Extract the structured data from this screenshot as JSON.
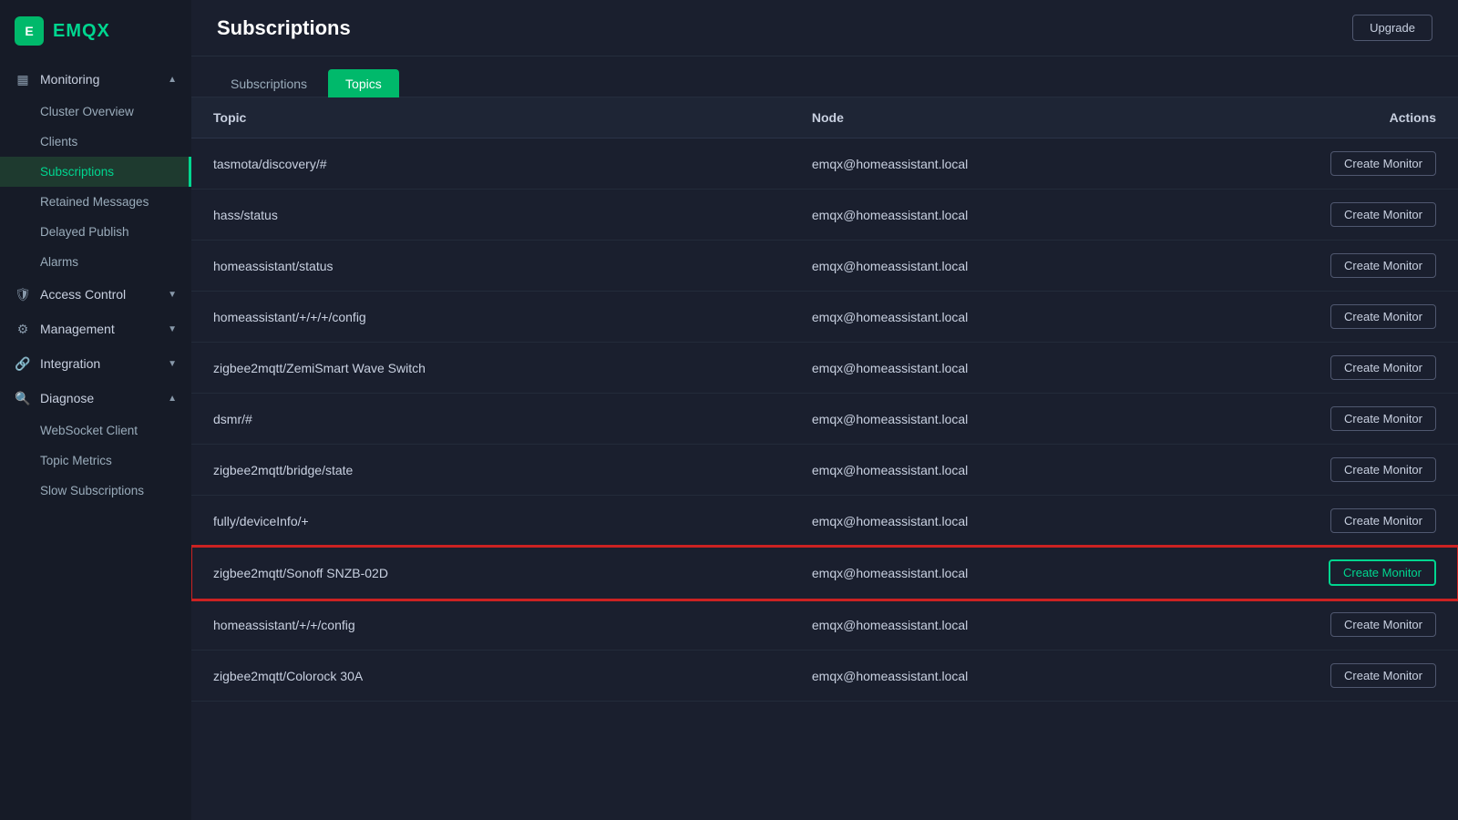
{
  "logo": {
    "icon": "E",
    "text": "EMQX"
  },
  "topbar": {
    "title": "Subscriptions",
    "upgrade_label": "Upgrade"
  },
  "sidebar": {
    "groups": [
      {
        "icon": "▦",
        "label": "Monitoring",
        "expanded": true,
        "items": [
          {
            "label": "Cluster Overview",
            "active": false
          },
          {
            "label": "Clients",
            "active": false
          },
          {
            "label": "Subscriptions",
            "active": true
          },
          {
            "label": "Retained Messages",
            "active": false
          },
          {
            "label": "Delayed Publish",
            "active": false
          },
          {
            "label": "Alarms",
            "active": false
          }
        ]
      },
      {
        "icon": "🛡",
        "label": "Access Control",
        "expanded": false,
        "items": []
      },
      {
        "icon": "⚙",
        "label": "Management",
        "expanded": false,
        "items": []
      },
      {
        "icon": "🔗",
        "label": "Integration",
        "expanded": false,
        "items": []
      },
      {
        "icon": "🔍",
        "label": "Diagnose",
        "expanded": true,
        "items": [
          {
            "label": "WebSocket Client",
            "active": false
          },
          {
            "label": "Topic Metrics",
            "active": false
          },
          {
            "label": "Slow Subscriptions",
            "active": false
          }
        ]
      }
    ]
  },
  "tabs": [
    {
      "label": "Subscriptions",
      "active": false
    },
    {
      "label": "Topics",
      "active": true
    }
  ],
  "table": {
    "headers": [
      "Topic",
      "Node",
      "Actions"
    ],
    "rows": [
      {
        "topic": "tasmota/discovery/#",
        "node": "emqx@homeassistant.local",
        "highlighted": false
      },
      {
        "topic": "hass/status",
        "node": "emqx@homeassistant.local",
        "highlighted": false
      },
      {
        "topic": "homeassistant/status",
        "node": "emqx@homeassistant.local",
        "highlighted": false
      },
      {
        "topic": "homeassistant/+/+/+/config",
        "node": "emqx@homeassistant.local",
        "highlighted": false
      },
      {
        "topic": "zigbee2mqtt/ZemiSmart Wave Switch",
        "node": "emqx@homeassistant.local",
        "highlighted": false
      },
      {
        "topic": "dsmr/#",
        "node": "emqx@homeassistant.local",
        "highlighted": false
      },
      {
        "topic": "zigbee2mqtt/bridge/state",
        "node": "emqx@homeassistant.local",
        "highlighted": false
      },
      {
        "topic": "fully/deviceInfo/+",
        "node": "emqx@homeassistant.local",
        "highlighted": false
      },
      {
        "topic": "zigbee2mqtt/Sonoff SNZB-02D",
        "node": "emqx@homeassistant.local",
        "highlighted": true
      },
      {
        "topic": "homeassistant/+/+/config",
        "node": "emqx@homeassistant.local",
        "highlighted": false
      },
      {
        "topic": "zigbee2mqtt/Colorock 30A",
        "node": "emqx@homeassistant.local",
        "highlighted": false
      }
    ],
    "action_label": "Create Monitor"
  }
}
